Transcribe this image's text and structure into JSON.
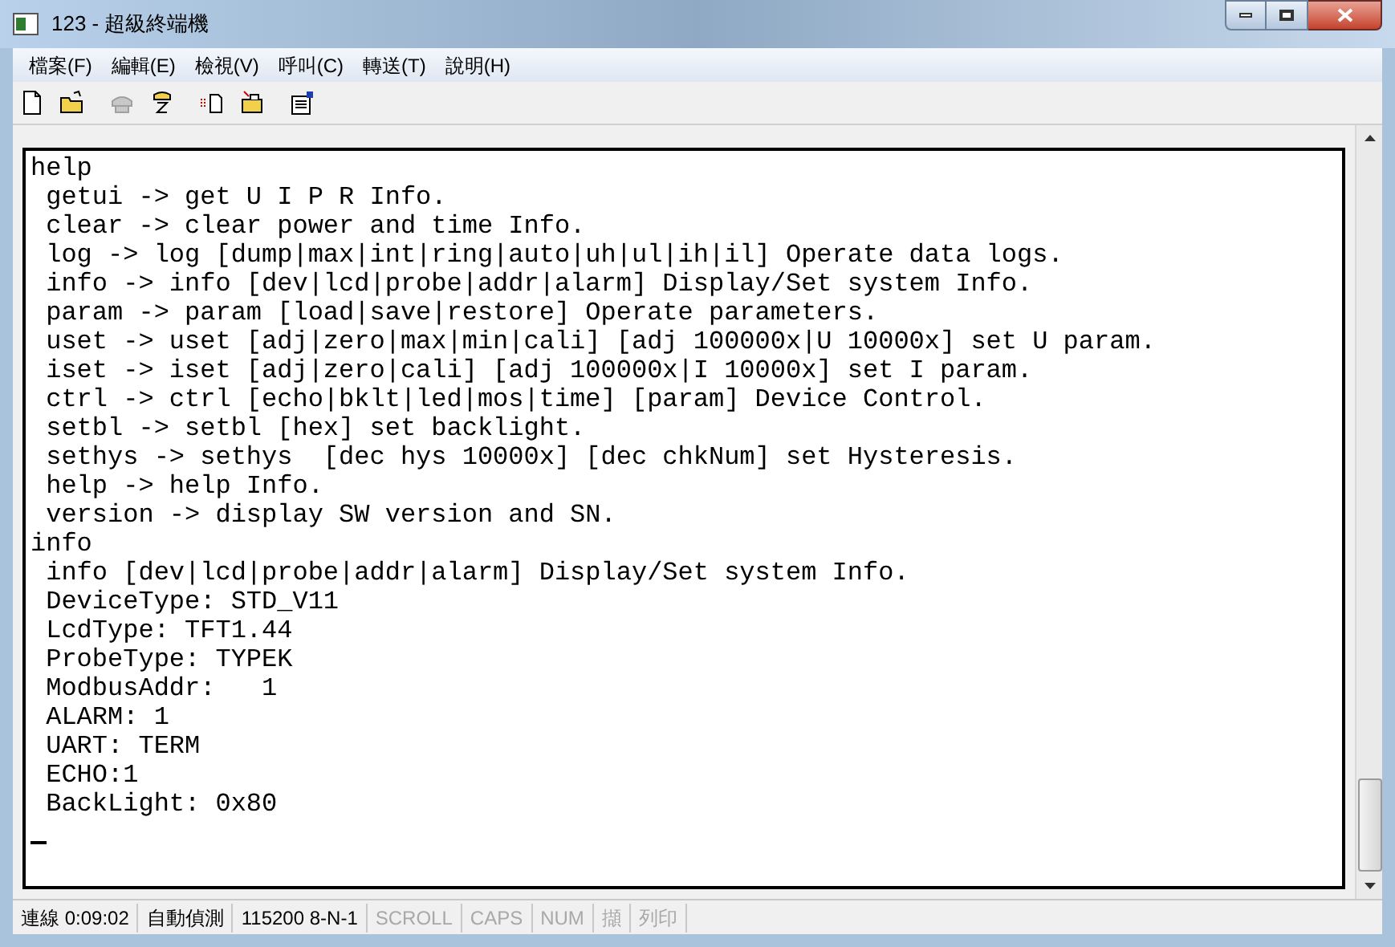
{
  "window": {
    "title": "123 - 超級終端機"
  },
  "menu": [
    "檔案(F)",
    "編輯(E)",
    "檢視(V)",
    "呼叫(C)",
    "轉送(T)",
    "說明(H)"
  ],
  "toolbar": [
    {
      "kind": "new",
      "disabled": false
    },
    {
      "kind": "open",
      "disabled": false
    },
    {
      "kind": "call",
      "disabled": true
    },
    {
      "kind": "hangup",
      "disabled": false
    },
    {
      "kind": "send",
      "disabled": false
    },
    {
      "kind": "receive",
      "disabled": false
    },
    {
      "kind": "properties",
      "disabled": false
    }
  ],
  "terminal": {
    "lines": [
      "help",
      " getui -> get U I P R Info.",
      " clear -> clear power and time Info.",
      " log -> log [dump|max|int|ring|auto|uh|ul|ih|il] Operate data logs.",
      " info -> info [dev|lcd|probe|addr|alarm] Display/Set system Info.",
      " param -> param [load|save|restore] Operate parameters.",
      " uset -> uset [adj|zero|max|min|cali] [adj 100000x|U 10000x] set U param.",
      " iset -> iset [adj|zero|cali] [adj 100000x|I 10000x] set I param.",
      " ctrl -> ctrl [echo|bklt|led|mos|time] [param] Device Control.",
      " setbl -> setbl [hex] set backlight.",
      " sethys -> sethys  [dec hys 10000x] [dec chkNum] set Hysteresis.",
      " help -> help Info.",
      " version -> display SW version and SN.",
      "info",
      " info [dev|lcd|probe|addr|alarm] Display/Set system Info.",
      " DeviceType: STD_V11",
      " LcdType: TFT1.44",
      " ProbeType: TYPEK",
      " ModbusAddr:   1",
      " ALARM: 1",
      " UART: TERM",
      " ECHO:1",
      " BackLight: 0x80"
    ],
    "cursor": true
  },
  "status_bar": [
    {
      "text": "連線 0:09:02",
      "disabled": false
    },
    {
      "text": "自動偵測",
      "disabled": false
    },
    {
      "text": "115200 8-N-1",
      "disabled": false
    },
    {
      "text": "SCROLL",
      "disabled": true
    },
    {
      "text": "CAPS",
      "disabled": true
    },
    {
      "text": "NUM",
      "disabled": true
    },
    {
      "text": "擷",
      "disabled": true
    },
    {
      "text": "列印",
      "disabled": true
    }
  ]
}
